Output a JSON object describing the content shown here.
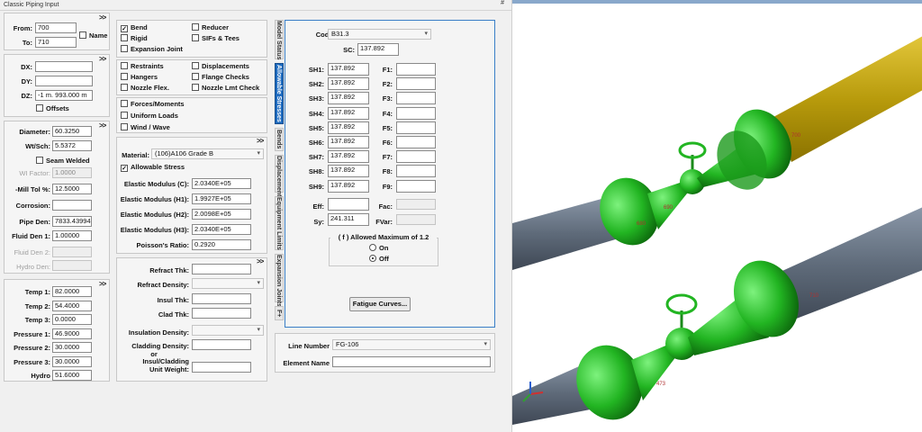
{
  "window": {
    "title": "Classic Piping Input",
    "pin": "#"
  },
  "nodes": {
    "from_label": "From:",
    "from": "700",
    "to_label": "To:",
    "to": "710",
    "name_label": "Name"
  },
  "offsets": {
    "dx_label": "DX:",
    "dx": "",
    "dy_label": "DY:",
    "dy": "",
    "dz_label": "DZ:",
    "dz": "-1 m.  993.000 m",
    "offsets_label": "Offsets"
  },
  "section": {
    "diameter_label": "Diameter:",
    "diameter": "60.3250",
    "wtsch_label": "Wt/Sch:",
    "wtsch": "5.5372",
    "seam_label": "Seam Welded",
    "wifactor_label": "WI Factor:",
    "wifactor": "1.0000",
    "milltol_label": "-Mill Tol %:",
    "milltol": "12.5000",
    "corrosion_label": "Corrosion:",
    "corrosion": "",
    "pipeden_label": "Pipe Den:",
    "pipeden": "7833.43994",
    "fluidden1_label": "Fluid Den 1:",
    "fluidden1": "1.00000",
    "fluidden2_label": "Fluid Den 2:",
    "hydroden_label": "Hydro Den:"
  },
  "operating": [
    {
      "label": "Temp 1:",
      "value": "82.0000"
    },
    {
      "label": "Temp 2:",
      "value": "54.4000"
    },
    {
      "label": "Temp 3:",
      "value": "0.0000"
    },
    {
      "label": "Pressure 1:",
      "value": "46.9000"
    },
    {
      "label": "Pressure 2:",
      "value": "30.0000"
    },
    {
      "label": "Pressure 3:",
      "value": "30.0000"
    },
    {
      "label": "Hydro",
      "value": "51.6000"
    }
  ],
  "elements": {
    "bend": "Bend",
    "reducer": "Reducer",
    "rigid": "Rigid",
    "sifs": "SIFs & Tees",
    "expansion": "Expansion Joint",
    "restraints": "Restraints",
    "displacements": "Displacements",
    "hangers": "Hangers",
    "flange": "Flange Checks",
    "nozzle_flex": "Nozzle Flex.",
    "nozzle_lmt": "Nozzle Lmt Check",
    "forces": "Forces/Moments",
    "uniform": "Uniform Loads",
    "wind": "Wind / Wave"
  },
  "material": {
    "label": "Material:",
    "value": "(106)A106 Grade B",
    "allowable_label": "Allowable Stress",
    "props": [
      {
        "label": "Elastic Modulus (C):",
        "value": "2.0340E+05"
      },
      {
        "label": "Elastic Modulus (H1):",
        "value": "1.9927E+05"
      },
      {
        "label": "Elastic Modulus (H2):",
        "value": "2.0098E+05"
      },
      {
        "label": "Elastic Modulus (H3):",
        "value": "2.0340E+05"
      },
      {
        "label": "Poisson's Ratio:",
        "value": "0.2920"
      }
    ]
  },
  "insulation": {
    "refract_thk": "Refract Thk:",
    "refract_den": "Refract Density:",
    "insul_thk": "Insul Thk:",
    "clad_thk": "Clad Thk:",
    "insul_den": "Insulation Density:",
    "clad_den": "Cladding Density:",
    "or": "or",
    "combo1": "Insul/Cladding",
    "combo2": "Unit Weight:"
  },
  "tabs": [
    "Model Status",
    "Allowable Stresses",
    "Bends",
    "Displacements",
    "Equipment Limits",
    "Expansion Joints",
    "F+"
  ],
  "allowables": {
    "code_label": "Code:",
    "code": "B31.3",
    "sc_label": "SC:",
    "sc": "137.892",
    "sh": [
      {
        "label": "SH1:",
        "value": "137.892"
      },
      {
        "label": "SH2:",
        "value": "137.892"
      },
      {
        "label": "SH3:",
        "value": "137.892"
      },
      {
        "label": "SH4:",
        "value": "137.892"
      },
      {
        "label": "SH5:",
        "value": "137.892"
      },
      {
        "label": "SH6:",
        "value": "137.892"
      },
      {
        "label": "SH7:",
        "value": "137.892"
      },
      {
        "label": "SH8:",
        "value": "137.892"
      },
      {
        "label": "SH9:",
        "value": "137.892"
      }
    ],
    "f": [
      "F1:",
      "F2:",
      "F3:",
      "F4:",
      "F5:",
      "F6:",
      "F7:",
      "F8:",
      "F9:"
    ],
    "eff_label": "Eff:",
    "fac_label": "Fac:",
    "sy_label": "Sy:",
    "sy": "241.311",
    "fvar_label": "FVar:",
    "allowed_group": "( f ) Allowed Maximum of 1.2",
    "on": "On",
    "off": "Off",
    "fatigue": "Fatigue Curves..."
  },
  "line": {
    "number_label": "Line Number",
    "number": "FG-106",
    "element_label": "Element Name"
  },
  "model_labels": {
    "a": "680",
    "b": "473",
    "c": "690",
    "d": "700",
    "e": "710"
  },
  "colors": {
    "pipe": "#5f6b7a",
    "fitting": "#2fbf2f",
    "tab_active": "#1e6bbf",
    "yellow_pipe": "#c8a910"
  }
}
